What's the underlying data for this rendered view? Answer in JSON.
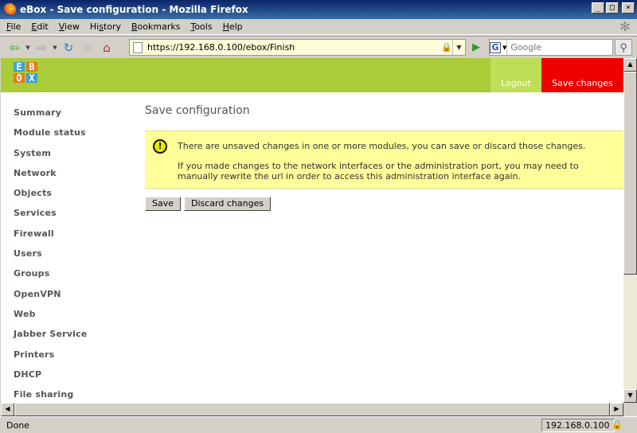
{
  "window": {
    "title": "eBox - Save configuration - Mozilla Firefox",
    "min": "_",
    "max": "□",
    "close": "×"
  },
  "menu": [
    {
      "ul": "F",
      "rest": "ile"
    },
    {
      "ul": "E",
      "rest": "dit"
    },
    {
      "ul": "V",
      "rest": "iew"
    },
    {
      "pre": "Hi",
      "ul": "s",
      "rest": "tory"
    },
    {
      "ul": "B",
      "rest": "ookmarks"
    },
    {
      "ul": "T",
      "rest": "ools"
    },
    {
      "ul": "H",
      "rest": "elp"
    }
  ],
  "menu_labels": [
    "File",
    "Edit",
    "View",
    "History",
    "Bookmarks",
    "Tools",
    "Help"
  ],
  "toolbar": {
    "url": "https://192.168.0.100/ebox/Finish",
    "search_placeholder": "Google"
  },
  "header": {
    "logo_letters": [
      "E",
      "B",
      "O",
      "X"
    ],
    "logout": "Logout",
    "save_changes": "Save changes",
    "colors": {
      "band": "#a9cc38",
      "save": "#ee0000"
    }
  },
  "sidebar": {
    "items": [
      "Summary",
      "Module status",
      "System",
      "Network",
      "Objects",
      "Services",
      "Firewall",
      "Users",
      "Groups",
      "OpenVPN",
      "Web",
      "Jabber Service",
      "Printers",
      "DHCP",
      "File sharing"
    ]
  },
  "main": {
    "title": "Save configuration",
    "notice": {
      "line1": "There are unsaved changes in one or more modules, you can save or discard those changes.",
      "line2": "If you made changes to the network interfaces or the administration port, you may need to manually rewrite the url in order to access this administration interface again."
    },
    "buttons": {
      "save": "Save",
      "discard": "Discard changes"
    }
  },
  "status": {
    "text": "Done",
    "host": "192.168.0.100"
  }
}
